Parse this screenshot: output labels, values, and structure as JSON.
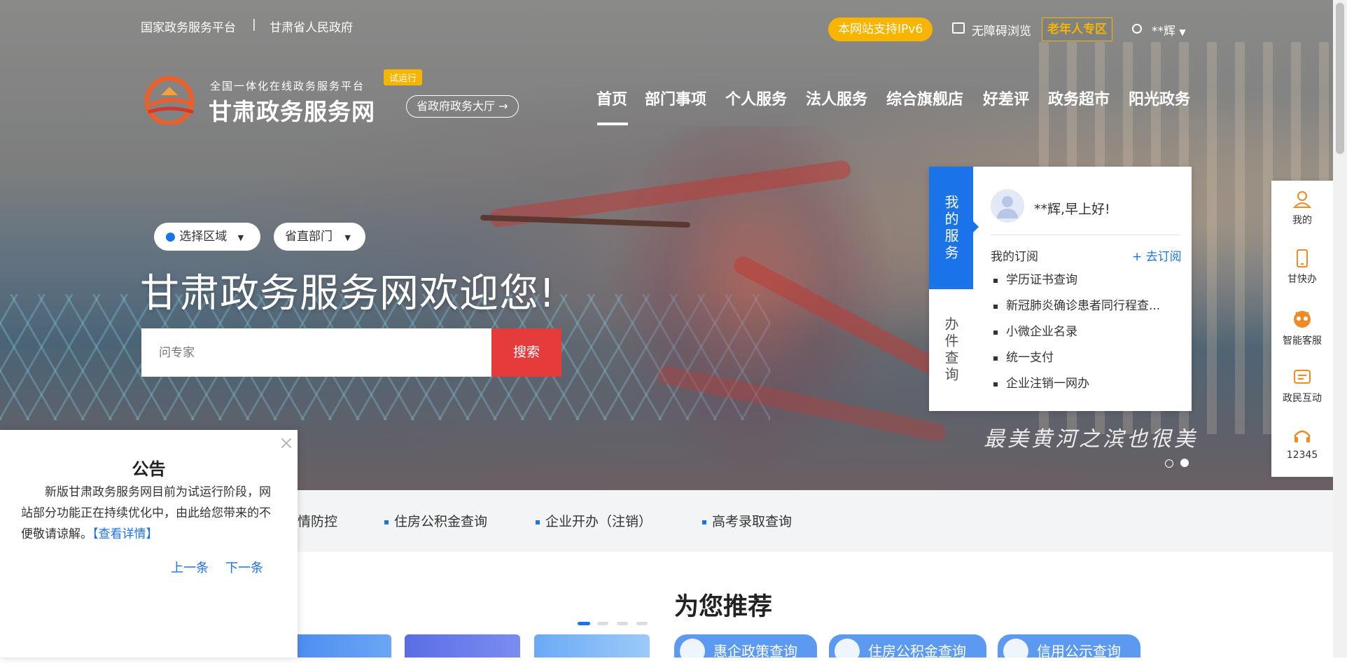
{
  "topbar": {
    "links": [
      "国家政务服务平台",
      "|",
      "甘肃省人民政府"
    ],
    "ipv6": "本网站支持IPv6",
    "accessible": "无障碍浏览",
    "elder": "老年人专区",
    "user": "**辉"
  },
  "logo": {
    "slogan": "全国一体化在线政务服务平台",
    "badge": "试运行",
    "name": "甘肃政务服务网",
    "hall_button": "省政府政务大厅"
  },
  "nav": [
    "首页",
    "部门事项",
    "个人服务",
    "法人服务",
    "综合旗舰店",
    "好差评",
    "政务超市",
    "阳光政务"
  ],
  "search": {
    "region": "选择区域",
    "dept": "省直部门",
    "welcome": "甘肃政务服务网欢迎您!",
    "placeholder": "问专家",
    "button": "搜索"
  },
  "banner_calligraphy": "最美黄河之滨也很美",
  "my_service": {
    "tab_service": "我的服务",
    "tab_query": "办件查询",
    "greeting": "**辉,早上好!",
    "subscription_title": "我的订阅",
    "subscribe_link": "+ 去订阅",
    "items": [
      "学历证书查询",
      "新冠肺炎确诊患者同行程查...",
      "小微企业名录",
      "统一支付",
      "企业注销一网办"
    ]
  },
  "sidebar": [
    {
      "label": "我的"
    },
    {
      "label": "甘快办"
    },
    {
      "label": "智能客服"
    },
    {
      "label": "政民互动"
    },
    {
      "label": "12345"
    }
  ],
  "quick_links": [
    "情防控",
    "住房公积金查询",
    "企业开办（注销）",
    "高考录取查询"
  ],
  "notice": {
    "title": "公告",
    "body": "新版甘肃政务服务网目前为试运行阶段，网站部分功能正在持续优化中，由此给您带来的不便敬请谅解。",
    "detail": "【查看详情】",
    "prev": "上一条",
    "next": "下一条"
  },
  "recommend": {
    "title": "为您推荐",
    "buttons": [
      "惠企政策查询",
      "住房公积金查询",
      "信用公示查询"
    ]
  },
  "colors": {
    "accent": "#1a73e8",
    "red": "#e63b3b",
    "gold": "#f7b500"
  }
}
